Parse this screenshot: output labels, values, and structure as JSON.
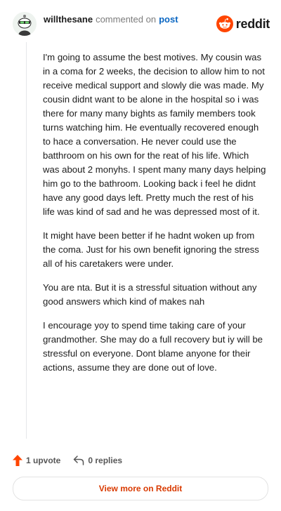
{
  "header": {
    "username": "willthesane",
    "commented_text": "commented on",
    "post_link": "post",
    "brand": "reddit",
    "brand_color": "#ff4500"
  },
  "comment": {
    "paragraphs": [
      "I'm going to assume the best motives. My cousin was in a coma for 2 weeks, the decision to allow him to not receive medical support and slowly die was made. My cousin didnt want to be alone in the hospital so i was there for many many bights as family members took turns watching him. He eventually recovered enough to hace a conversation. He never could use the batthroom on his own for the reat of his life. Which was about 2 monyhs. I spent many many days helping him go to the bathroom. Looking back i feel he didnt have any good days left. Pretty much the rest of his life was kind of sad and he was depressed most of it.",
      "It might have been better if he hadnt woken up from the coma. Just for his own benefit ignoring the stress all of his caretakers were under.",
      "You are nta. But it is a stressful situation without any good answers which kind of makes nah",
      "I encourage yoy to spend time taking care of your grandmother. She may do a full recovery but iy will be stressful on everyone. Dont blame anyone for their actions, assume they are done out of love."
    ]
  },
  "footer": {
    "upvotes": "1 upvote",
    "replies": "0 replies",
    "view_more": "View more on Reddit",
    "upvote_color": "#ff4500",
    "view_more_color": "#d93a00"
  },
  "icons": {
    "avatar": "snoo-avatar-icon",
    "brand_logo": "reddit-logo-icon",
    "upvote": "upvote-arrow-icon",
    "reply": "reply-arrow-icon"
  }
}
